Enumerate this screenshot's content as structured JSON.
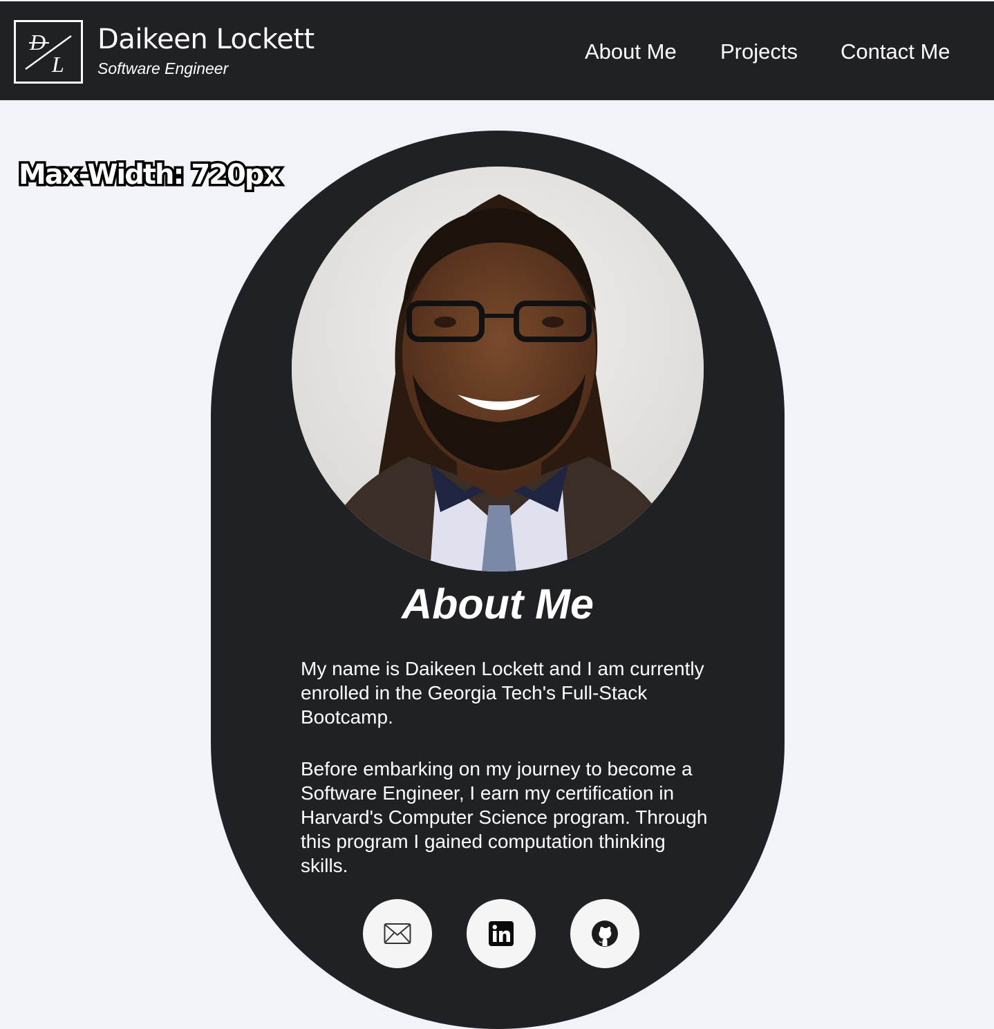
{
  "header": {
    "logo_letters": "D/L",
    "name": "Daikeen Lockett",
    "role": "Software Engineer",
    "nav": [
      {
        "label": "About Me"
      },
      {
        "label": "Projects"
      },
      {
        "label": "Contact Me"
      }
    ]
  },
  "overlay_label": "Max-Width: 720px",
  "about": {
    "title": "About Me",
    "paragraphs": [
      "My name is Daikeen Lockett and I am currently enrolled in the Georgia Tech's Full-Stack Bootcamp.",
      "Before embarking on my journey to become a Software Engineer, I earn my certification in Harvard's Computer Science program. Through this program I gained computation thinking skills."
    ],
    "social_icons": [
      "email-icon",
      "linkedin-icon",
      "github-icon"
    ]
  },
  "colors": {
    "header_bg": "#202124",
    "page_bg": "#f0f4f8",
    "card_bg": "#202124",
    "text_light": "#ffffff",
    "icon_circle_bg": "#f5f5f5"
  }
}
